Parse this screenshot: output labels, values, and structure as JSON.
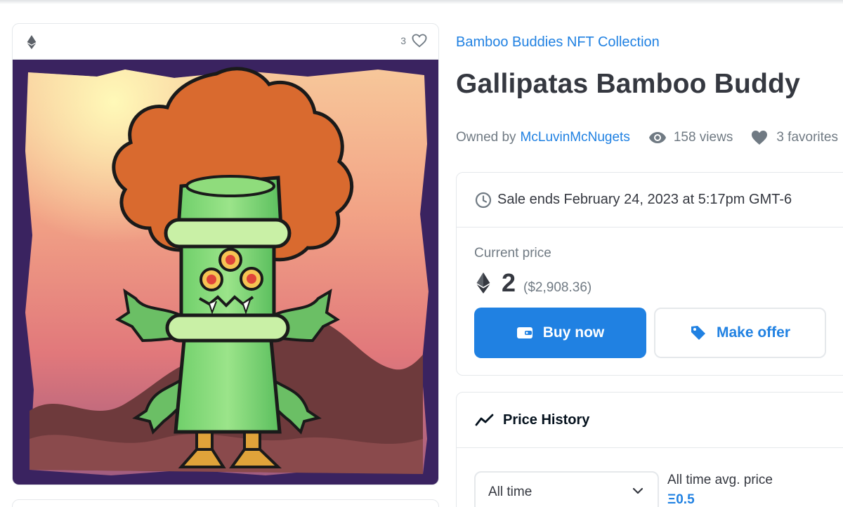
{
  "item": {
    "collection": "Bamboo Buddies NFT Collection",
    "title": "Gallipatas Bamboo Buddy",
    "owned_by_label": "Owned by",
    "owner": "McLuvinMcNugets",
    "views": "158 views",
    "favorites": "3 favorites",
    "card_favorite_count": "3"
  },
  "sale": {
    "ends_text": "Sale ends February 24, 2023 at 5:17pm GMT-6",
    "current_price_label": "Current price",
    "price_eth": "2",
    "price_usd": "($2,908.36)",
    "buy_label": "Buy now",
    "offer_label": "Make offer"
  },
  "history": {
    "title": "Price History",
    "range_value": "All time",
    "avg_label": "All time avg. price",
    "avg_value": "Ξ0.5"
  },
  "colors": {
    "accent": "#2081e2",
    "text_primary": "#353840",
    "text_secondary": "#707a83",
    "border": "#e5e8eb"
  },
  "icons": {
    "chain": "ethereum-icon",
    "favorite": "heart-icon",
    "views": "eye-icon",
    "timer": "clock-icon",
    "buy": "wallet-icon",
    "offer": "tag-icon",
    "history": "trend-line-icon",
    "dropdown": "chevron-down-icon"
  }
}
